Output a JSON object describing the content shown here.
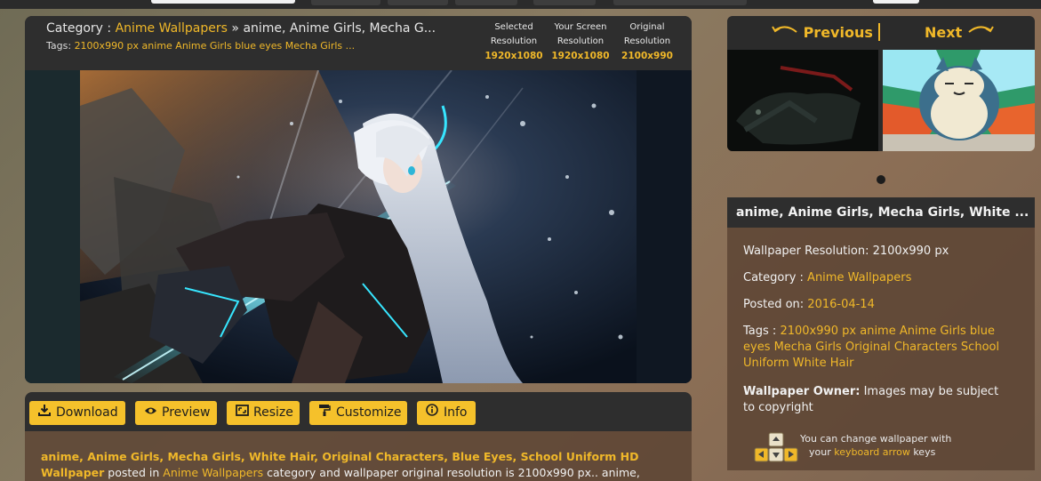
{
  "header": {
    "category_label": "Category :",
    "category_value": "Anime Wallpapers",
    "separator": "»",
    "title_short": "anime, Anime Girls, Mecha G...",
    "tags_label": "Tags:",
    "tags_short": "2100x990 px anime Anime Girls blue eyes Mecha Girls ..."
  },
  "resolutions": [
    {
      "label_line1": "Selected",
      "label_line2": "Resolution",
      "value": "1920x1080"
    },
    {
      "label_line1": "Your Screen",
      "label_line2": "Resolution",
      "value": "1920x1080"
    },
    {
      "label_line1": "Original",
      "label_line2": "Resolution",
      "value": "2100x990"
    }
  ],
  "toolbar": {
    "download": "Download",
    "preview": "Preview",
    "resize": "Resize",
    "customize": "Customize",
    "info": "Info"
  },
  "description": {
    "bold_title": "anime, Anime Girls, Mecha Girls, White Hair, Original Characters, Blue Eyes, School Uniform HD Wallpaper",
    "posted_in": " posted in",
    "category_link": "Anime Wallpapers",
    "rest": " category and wallpaper original resolution is 2100x990 px.. anime, Anime Girls, Mecha Girls, White"
  },
  "nav": {
    "previous": "Previous",
    "next": "Next"
  },
  "info": {
    "title": "anime, Anime Girls, Mecha Girls, White ...",
    "resolution_text": "Wallpaper Resolution: 2100x990 px",
    "category_label": "Category :",
    "category_value": "Anime Wallpapers",
    "posted_label": "Posted on:",
    "posted_value": "2016-04-14",
    "tags_label": "Tags :",
    "tags_value": "2100x990 px anime Anime Girls blue eyes Mecha Girls Original Characters School Uniform White Hair",
    "owner_label": "Wallpaper Owner:",
    "owner_text": "Images may be subject to copyright",
    "kb_line1": "You can change wallpaper with",
    "kb_line2_prefix": "your ",
    "kb_link": "keyboard arrow",
    "kb_line2_suffix": " keys"
  },
  "colors": {
    "accent": "#f0b829",
    "panel": "#2e2e2e",
    "info_bg": "#5c4434",
    "button_bg": "#f5c12b"
  },
  "icons": {
    "download": "download-icon",
    "preview": "eye-icon",
    "resize": "resize-icon",
    "customize": "paint-roller-icon",
    "info": "info-icon",
    "previous": "curved-arrow-left-icon",
    "next": "curved-arrow-right-icon",
    "keyboard": "keyboard-arrows-icon"
  }
}
